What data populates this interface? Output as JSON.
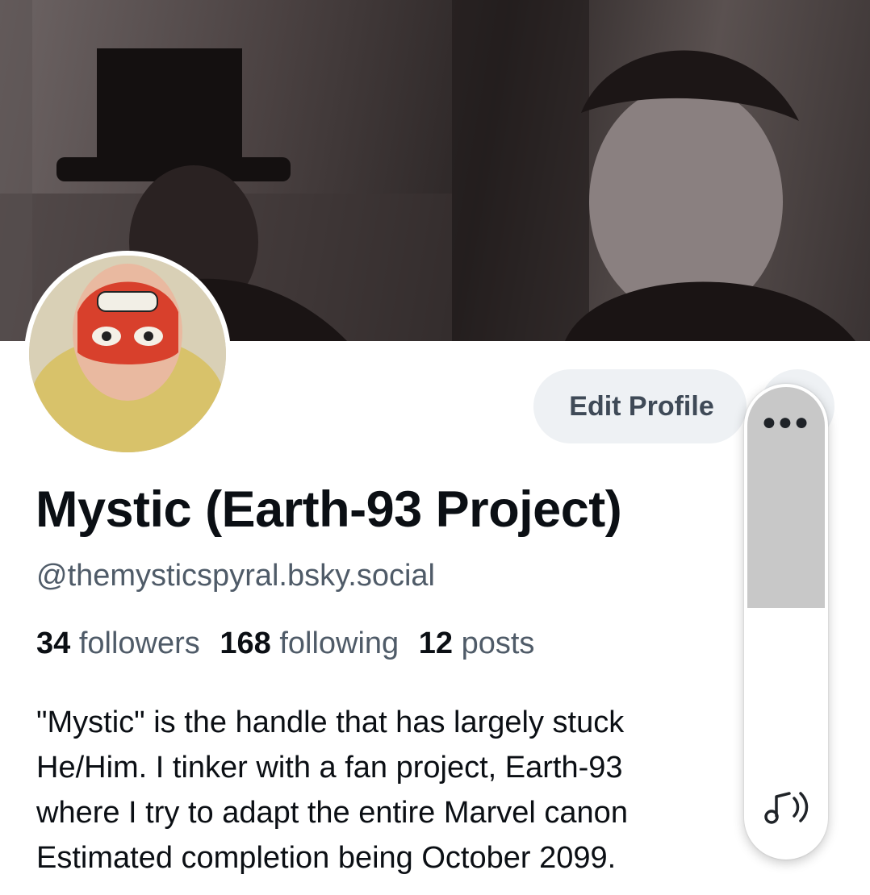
{
  "profile": {
    "display_name": "Mystic (Earth-93 Project)",
    "handle": "@themysticspyral.bsky.social",
    "edit_button_label": "Edit Profile",
    "more_button_icon": "more-horizontal-icon"
  },
  "stats": {
    "followers_count": "34",
    "followers_label": "followers",
    "following_count": "168",
    "following_label": "following",
    "posts_count": "12",
    "posts_label": "posts"
  },
  "bio": {
    "lines": [
      "\"Mystic\" is the handle that has largely stuck",
      "He/Him. I tinker with a fan project, Earth-93",
      "where I try to adapt the entire Marvel canon",
      "Estimated completion being October 2099."
    ]
  },
  "overlay": {
    "menu_icon": "ellipsis-icon",
    "sound_icon": "sound-wave-icon",
    "level_fraction": 0.47
  },
  "colors": {
    "accent_button_bg": "#eef1f4",
    "secondary_text": "#4f5b68",
    "primary_text": "#0b0f14"
  }
}
